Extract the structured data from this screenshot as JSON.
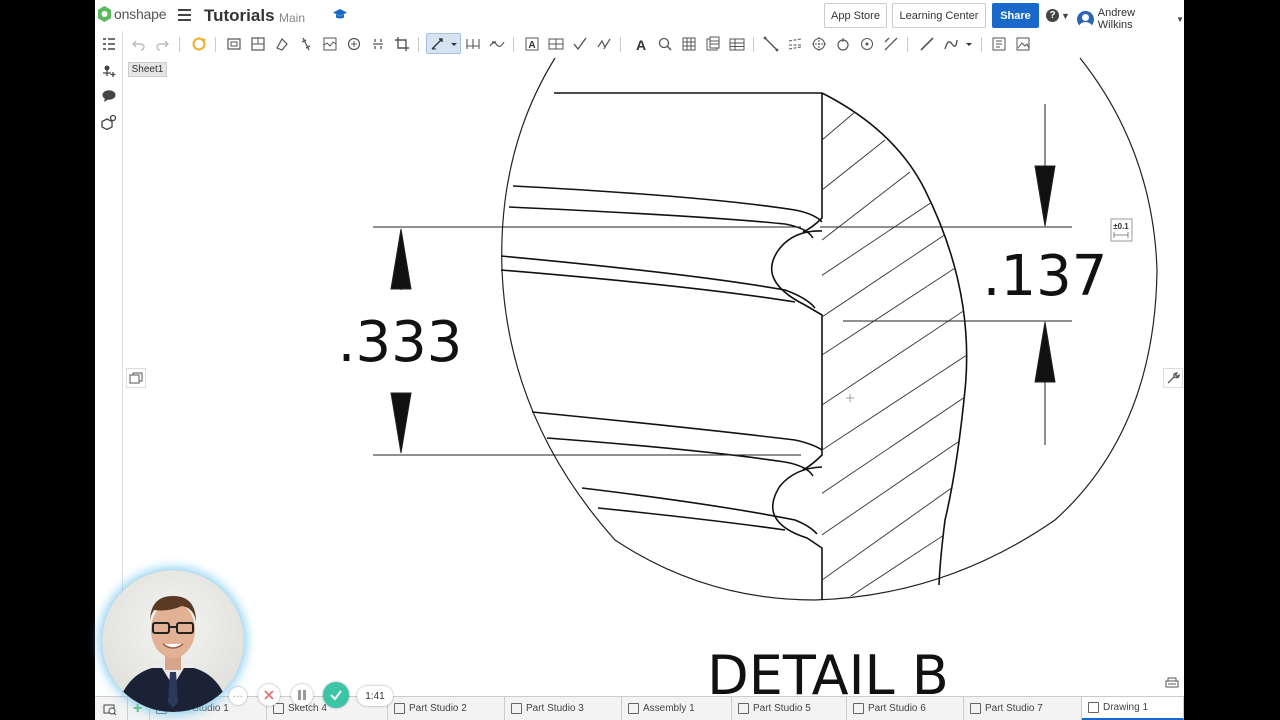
{
  "app": {
    "logo_text": "onshape",
    "document_title": "Tutorials",
    "branch": "Main",
    "user_name": "Andrew Wilkins"
  },
  "header": {
    "app_store_label": "App Store",
    "learning_center_label": "Learning Center",
    "share_label": "Share",
    "help_icon": "?"
  },
  "sheet": {
    "label": "Sheet1"
  },
  "drawing": {
    "dimension_left": ".333",
    "dimension_right": ".137",
    "detail_label": "DETAIL B",
    "tolerance_label": "±0.1"
  },
  "tabs": [
    {
      "label": "Part Studio 1"
    },
    {
      "label": "Sketch 4"
    },
    {
      "label": "Part Studio 2"
    },
    {
      "label": "Part Studio 3"
    },
    {
      "label": "Assembly 1"
    },
    {
      "label": "Part Studio 5"
    },
    {
      "label": "Part Studio 6"
    },
    {
      "label": "Part Studio 7"
    },
    {
      "label": "Drawing 1"
    }
  ],
  "recording": {
    "timer": "1:41",
    "more": "···"
  },
  "colors": {
    "accent": "#1a68c9",
    "logo_green": "#5cb85c",
    "record_check": "#3cc5a4",
    "record_close": "#e27373"
  }
}
